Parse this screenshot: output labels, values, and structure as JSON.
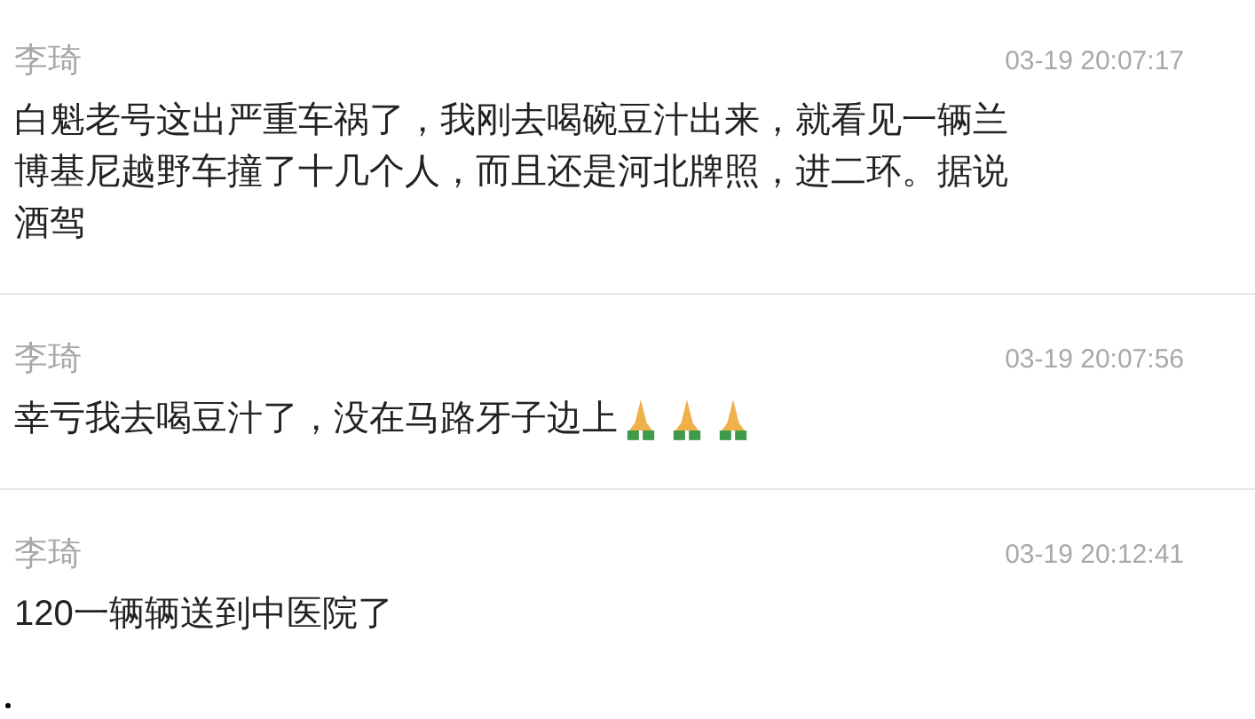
{
  "comments": [
    {
      "author": "李琦",
      "time": "03-19 20:07:17",
      "text": "白魁老号这出严重车祸了，我刚去喝碗豆汁出来，就看见一辆兰博基尼越野车撞了十几个人，而且还是河北牌照，进二环。据说酒驾"
    },
    {
      "author": "李琦",
      "time": "03-19 20:07:56",
      "text": "幸亏我去喝豆汁了，没在马路牙子边上",
      "emoji": [
        {
          "kind": "pray"
        },
        {
          "kind": "pray"
        },
        {
          "kind": "pray"
        }
      ]
    },
    {
      "author": "李琦",
      "time": "03-19 20:12:41",
      "text": "120一辆辆送到中医院了"
    }
  ]
}
